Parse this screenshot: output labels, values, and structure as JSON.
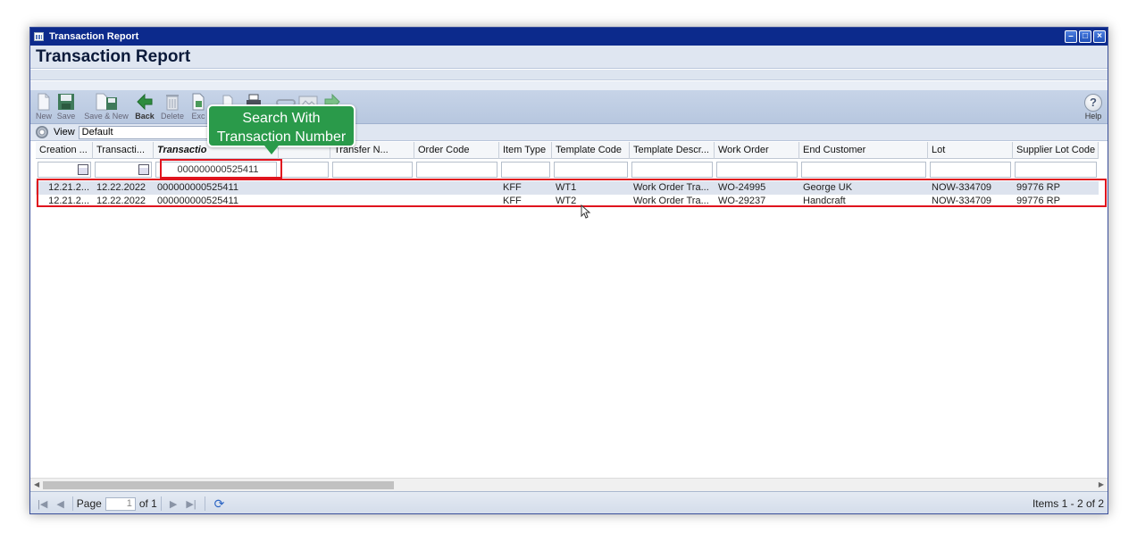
{
  "window": {
    "title": "Transaction Report"
  },
  "header": {
    "title": "Transaction Report"
  },
  "toolbar": {
    "items": [
      {
        "label": "New"
      },
      {
        "label": "Save"
      },
      {
        "label": "Save & New"
      },
      {
        "label": "Back"
      },
      {
        "label": "Delete"
      },
      {
        "label": "Exc"
      }
    ],
    "help_label": "Help",
    "help_glyph": "?"
  },
  "viewbar": {
    "label": "View",
    "value": "Default"
  },
  "grid": {
    "columns": [
      {
        "label": "Creation ..."
      },
      {
        "label": "Transacti..."
      },
      {
        "label": "Transactio"
      },
      {
        "label": ""
      },
      {
        "label": "Transfer N..."
      },
      {
        "label": "Order Code"
      },
      {
        "label": "Item Type"
      },
      {
        "label": "Template Code"
      },
      {
        "label": "Template Descr..."
      },
      {
        "label": "Work Order"
      },
      {
        "label": "End Customer"
      },
      {
        "label": "Lot"
      },
      {
        "label": "Supplier Lot Code"
      }
    ],
    "filter_value": "000000000525411",
    "rows": [
      [
        "12.21.2...",
        "12.22.2022",
        "000000000525411",
        "",
        "",
        "",
        "KFF",
        "WT1",
        "Work Order Tra...",
        "WO-24995",
        "George UK",
        "NOW-334709",
        "99776 RP"
      ],
      [
        "12.21.2...",
        "12.22.2022",
        "000000000525411",
        "",
        "",
        "",
        "KFF",
        "WT2",
        "Work Order Tra...",
        "WO-29237",
        "Handcraft",
        "NOW-334709",
        "99776 RP"
      ]
    ]
  },
  "callout": {
    "line1": "Search With",
    "line2": "Transaction Number"
  },
  "pager": {
    "page_label": "Page",
    "page_value": "1",
    "of_label": "of 1",
    "items_label": "Items 1 - 2 of 2"
  },
  "colors": {
    "titlebar": "#0c2a8c",
    "callout": "#2a9a4a",
    "highlight": "#e0141e"
  }
}
